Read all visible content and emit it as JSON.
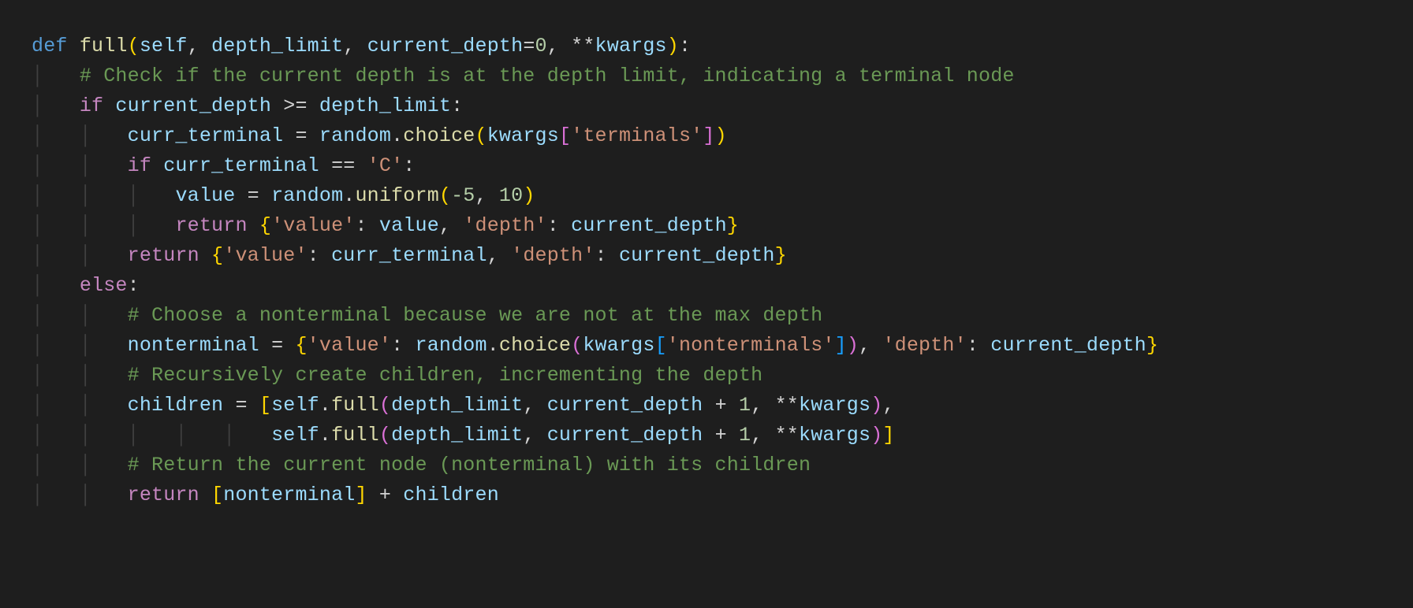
{
  "code": {
    "lang": "python",
    "func_name": "full",
    "params": [
      "self",
      "depth_limit",
      "current_depth",
      "**kwargs"
    ],
    "default_current_depth": 0,
    "comments": {
      "l2": "# Check if the current depth is at the depth limit, indicating a terminal node",
      "l10": "# Choose a nonterminal because we are not at the max depth",
      "l12": "# Recursively create children, incrementing the depth",
      "l15": "# Return the current node (nonterminal) with its children"
    },
    "strings": {
      "terminals": "'terminals'",
      "C": "'C'",
      "value": "'value'",
      "depth": "'depth'",
      "nonterminals": "'nonterminals'"
    },
    "numbers": {
      "neg5": "-5",
      "ten": "10",
      "one": "1",
      "zero": "0"
    },
    "identifiers": {
      "curr_terminal": "curr_terminal",
      "random": "random",
      "choice": "choice",
      "kwargs": "kwargs",
      "value": "value",
      "uniform": "uniform",
      "current_depth": "current_depth",
      "depth_limit": "depth_limit",
      "nonterminal": "nonterminal",
      "children": "children",
      "self": "self",
      "full": "full"
    },
    "keywords": {
      "def": "def",
      "if": "if",
      "else": "else",
      "return": "return"
    }
  }
}
